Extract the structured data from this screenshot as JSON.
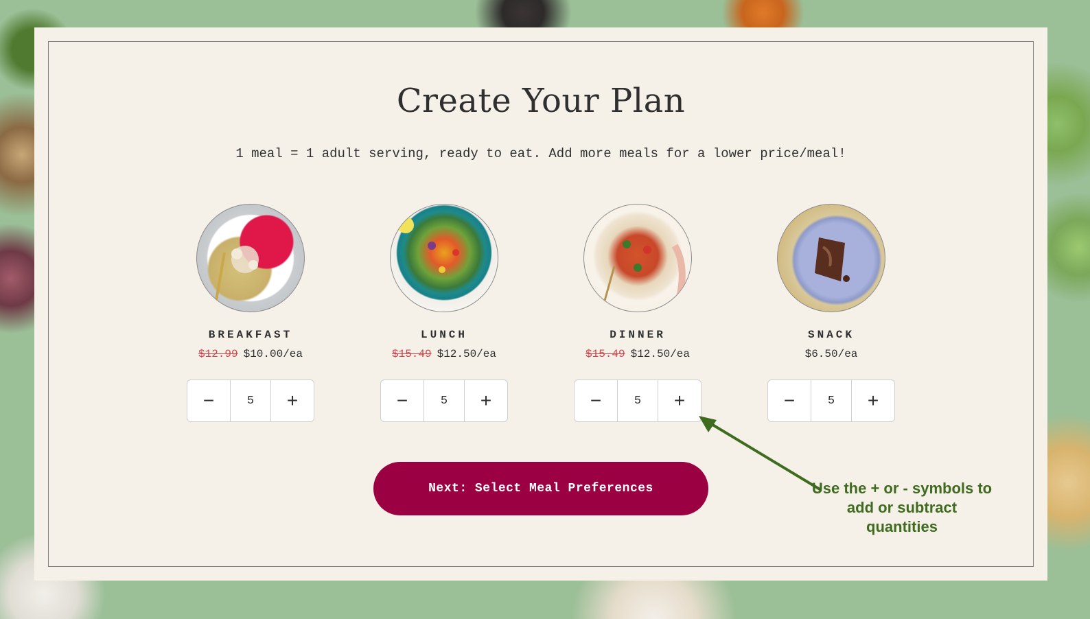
{
  "plan": {
    "title": "Create Your Plan",
    "subtitle": "1 meal = 1 adult serving, ready to eat. Add more meals for a lower price/meal!"
  },
  "meals": [
    {
      "name": "BREAKFAST",
      "old_price": "$12.99",
      "price": "$10.00/ea",
      "quantity": "5",
      "minus_label": "−",
      "plus_label": "+"
    },
    {
      "name": "LUNCH",
      "old_price": "$15.49",
      "price": "$12.50/ea",
      "quantity": "5",
      "minus_label": "−",
      "plus_label": "+"
    },
    {
      "name": "DINNER",
      "old_price": "$15.49",
      "price": "$12.50/ea",
      "quantity": "5",
      "minus_label": "−",
      "plus_label": "+"
    },
    {
      "name": "SNACK",
      "old_price": "",
      "price": "$6.50/ea",
      "quantity": "5",
      "minus_label": "−",
      "plus_label": "+"
    }
  ],
  "next_button": {
    "label": "Next: Select Meal Preferences"
  },
  "annotation": {
    "text": "Use the + or - symbols to add or subtract quantities",
    "color": "#3f6b1f"
  },
  "colors": {
    "accent": "#9a0042",
    "strike_price": "#d2454b",
    "card_bg": "#f6f1e8"
  }
}
